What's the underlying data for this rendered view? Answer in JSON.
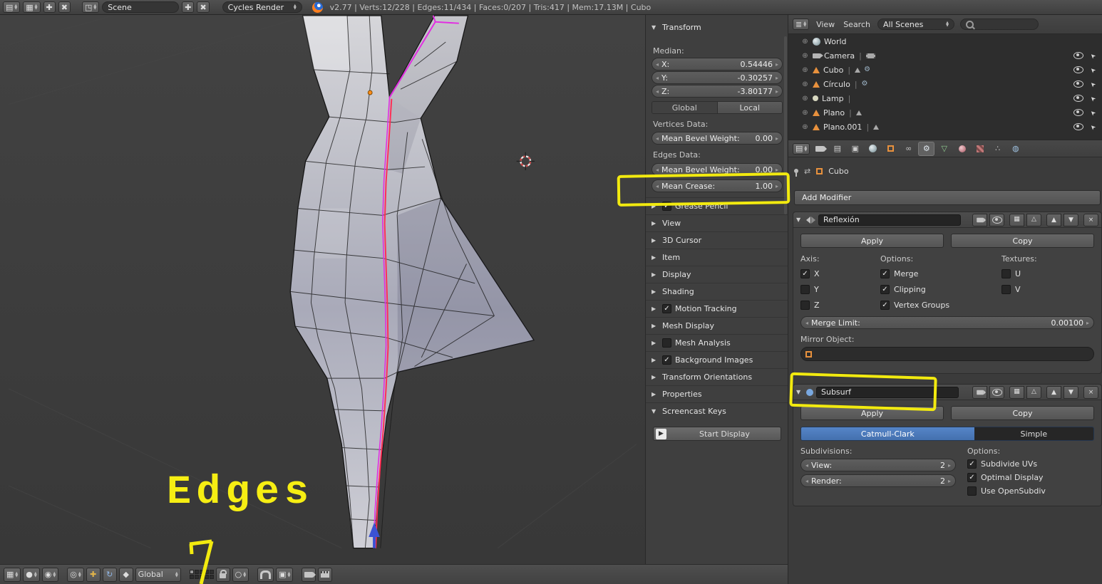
{
  "header": {
    "scene_name": "Scene",
    "engine": "Cycles Render",
    "stats": "v2.77 | Verts:12/228 | Edges:11/434 | Faces:0/207 | Tris:417 | Mem:17.13M | Cubo"
  },
  "viewport": {
    "annotation": "Edges",
    "toolbar": {
      "orientation": "Global"
    }
  },
  "colors": {
    "accent_blue": "#4772b3",
    "annotation_yellow": "#f2ea0f",
    "selected_edge_pink": "#ff2d55",
    "seam_magenta": "#e22ce2",
    "mesh_object_orange": "#e8913d"
  },
  "npanel": {
    "transform_title": "Transform",
    "median_label": "Median:",
    "fields": {
      "x": {
        "label": "X:",
        "value": "0.54446"
      },
      "y": {
        "label": "Y:",
        "value": "-0.30257"
      },
      "z": {
        "label": "Z:",
        "value": "-3.80177"
      }
    },
    "global_button": "Global",
    "local_button": "Local",
    "vertices_data_label": "Vertices Data:",
    "vertex_bevel": {
      "label": "Mean Bevel Weight:",
      "value": "0.00"
    },
    "edges_data_label": "Edges Data:",
    "edge_bevel": {
      "label": "Mean Bevel Weight:",
      "value": "0.00"
    },
    "mean_crease": {
      "label": "Mean Crease:",
      "value": "1.00"
    },
    "panels": [
      {
        "label": "Grease Pencil",
        "checkbox": true,
        "checked": true
      },
      {
        "label": "View",
        "checkbox": false
      },
      {
        "label": "3D Cursor",
        "checkbox": false
      },
      {
        "label": "Item",
        "checkbox": false
      },
      {
        "label": "Display",
        "checkbox": false
      },
      {
        "label": "Shading",
        "checkbox": false
      },
      {
        "label": "Motion Tracking",
        "checkbox": true,
        "checked": true
      },
      {
        "label": "Mesh Display",
        "checkbox": false
      },
      {
        "label": "Mesh Analysis",
        "checkbox": true,
        "checked": false
      },
      {
        "label": "Background Images",
        "checkbox": true,
        "checked": true
      },
      {
        "label": "Transform Orientations",
        "checkbox": false
      },
      {
        "label": "Properties",
        "checkbox": false
      }
    ],
    "screencast_title": "Screencast Keys",
    "start_display_button": "Start Display"
  },
  "outliner": {
    "view_menu": "View",
    "search_menu": "Search",
    "scene_filter": "All Scenes",
    "items": [
      {
        "name": "World"
      },
      {
        "name": "Camera"
      },
      {
        "name": "Cubo"
      },
      {
        "name": "Círculo"
      },
      {
        "name": "Lamp"
      },
      {
        "name": "Plano"
      },
      {
        "name": "Plano.001"
      }
    ]
  },
  "properties": {
    "breadcrumb_object": "Cubo",
    "add_modifier_button": "Add Modifier",
    "modifiers": [
      {
        "name": "Reflexión",
        "apply_button": "Apply",
        "copy_button": "Copy",
        "axis_label": "Axis:",
        "options_label": "Options:",
        "textures_label": "Textures:",
        "axis_x": "X",
        "axis_x_checked": true,
        "axis_y": "Y",
        "axis_y_checked": false,
        "axis_z": "Z",
        "axis_z_checked": false,
        "opt_merge": "Merge",
        "opt_merge_checked": true,
        "opt_clipping": "Clipping",
        "opt_clipping_checked": true,
        "opt_vgroups": "Vertex Groups",
        "opt_vgroups_checked": true,
        "tex_u": "U",
        "tex_u_checked": false,
        "tex_v": "V",
        "tex_v_checked": false,
        "merge_limit_label": "Merge Limit:",
        "merge_limit_value": "0.00100",
        "mirror_object_label": "Mirror Object:"
      },
      {
        "name": "Subsurf",
        "apply_button": "Apply",
        "copy_button": "Copy",
        "catmull_button": "Catmull-Clark",
        "simple_button": "Simple",
        "subdivisions_label": "Subdivisions:",
        "options_label": "Options:",
        "view": {
          "label": "View:",
          "value": "2"
        },
        "render": {
          "label": "Render:",
          "value": "2"
        },
        "opt_subdivide_uvs": "Subdivide UVs",
        "opt_subdivide_uvs_checked": true,
        "opt_optimal_display": "Optimal Display",
        "opt_optimal_display_checked": true,
        "opt_opensubdiv": "Use OpenSubdiv",
        "opt_opensubdiv_checked": false
      }
    ]
  }
}
